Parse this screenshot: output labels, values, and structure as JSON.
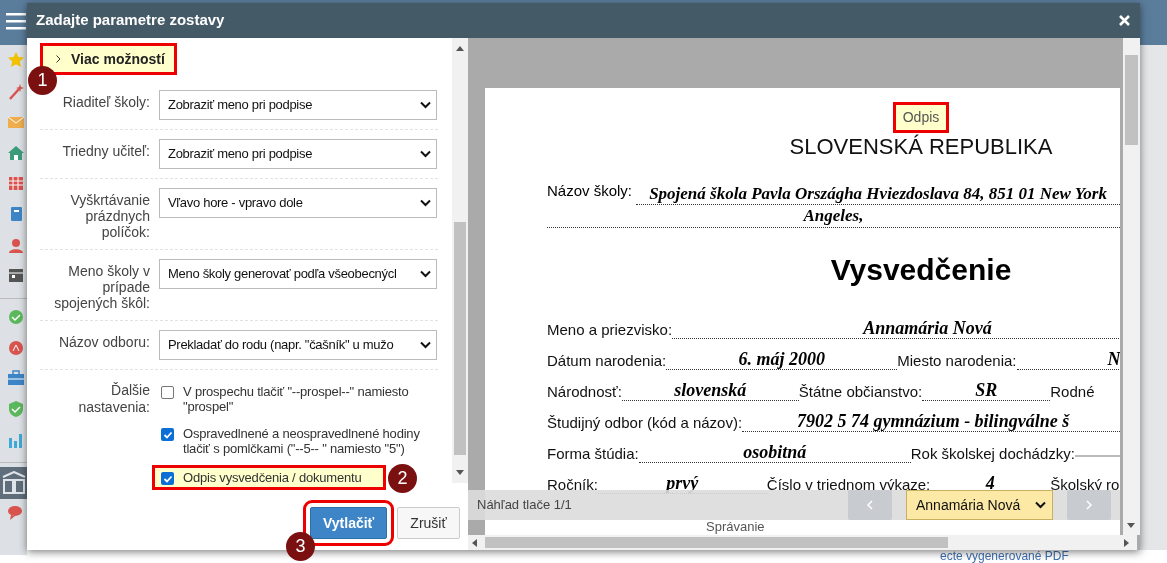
{
  "dialog": {
    "title": "Zadajte parametre zostavy"
  },
  "more_options": {
    "label": "Viac možností"
  },
  "fields": [
    {
      "label": "Riaditeľ školy:",
      "value": "Zobraziť meno pri podpise"
    },
    {
      "label": "Triedny učiteľ:",
      "value": "Zobraziť meno pri podpise"
    },
    {
      "label": "Vyškrtávanie prázdnych políčok:",
      "value": "Vľavo hore - vpravo dole"
    },
    {
      "label": "Meno školy v prípade spojených škôl:",
      "value": "Meno školy generovať podľa všeobecnýcl"
    },
    {
      "label": "Názov odboru:",
      "value": "Prekladať do rodu (napr. \"čašník\" u mužo"
    }
  ],
  "extra_label": "Ďalšie nastavenia:",
  "options": [
    {
      "label": "V prospechu tlačiť \"--prospel--\" namiesto \"prospel\"",
      "checked": false,
      "highlighted": false
    },
    {
      "label": "Ospravedlnené a neospravedlnené hodiny tlačiť s pomlčkami (\"--5-- \" namiesto \"5\")",
      "checked": true,
      "highlighted": false
    },
    {
      "label": "Odpis vysvedčenia / dokumentu",
      "checked": true,
      "highlighted": true
    }
  ],
  "buttons": [
    {
      "label": "Vytlačiť",
      "kind": "primary",
      "highlighted": true
    },
    {
      "label": "Zrušiť",
      "kind": "secondary",
      "highlighted": false
    }
  ],
  "preview": {
    "badge": "Odpis",
    "country": "SLOVENSKÁ REPUBLIKA",
    "school_label": "Názov školy:",
    "school_name": "Spojená škola Pavla Országha Hviezdoslava 84, 851 01 New York",
    "school_name_cont": "Angeles,",
    "title": "Vysvedčenie",
    "rows": [
      [
        {
          "label": "Meno a priezvisko:",
          "value": "Annamária Nová"
        }
      ],
      [
        {
          "label": "Dátum narodenia:",
          "value": "6. máj 2000"
        },
        {
          "label": "Miesto narodenia:",
          "value": "N"
        }
      ],
      [
        {
          "label": "Národnosť:",
          "value": "slovenská"
        },
        {
          "label": "Štátne občianstvo:",
          "value": "SR"
        },
        {
          "label": "Rodné"
        }
      ],
      [
        {
          "label": "Študijný odbor (kód a názov):",
          "value": "7902 5 74 gymnázium - bilingválne š"
        }
      ],
      [
        {
          "label": "Forma štúdia:",
          "value": "osobitná"
        },
        {
          "label": "Rok školskej dochádzky:",
          "blank_line": true
        }
      ],
      [
        {
          "label": "Ročník:",
          "value": "prvý"
        },
        {
          "label": "Číslo v triednom výkaze:",
          "value": "4"
        },
        {
          "label": "Školský ro"
        }
      ]
    ],
    "table_cell": "Správanie"
  },
  "print_bar": {
    "page_info": "Náhľad tlače 1/1",
    "student": "Annamária Nová"
  },
  "annotations": [
    "1",
    "2",
    "3"
  ],
  "background_link": "ecte vygenerované PDF"
}
